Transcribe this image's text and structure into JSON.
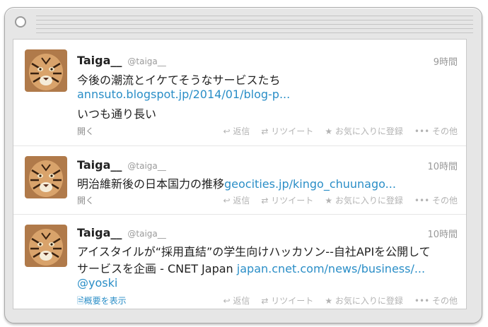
{
  "tweets": [
    {
      "name": "Taiga__",
      "handle": "@taiga__",
      "time": "9時間",
      "lines": [
        {
          "text": "今後の潮流とイケてそうなサービスたち",
          "link": ""
        },
        {
          "text": "",
          "link": "annsuto.blogspot.jp/2014/01/blog-p..."
        },
        {
          "text": "いつも通り長い",
          "link": ""
        }
      ],
      "expand": "開く"
    },
    {
      "name": "Taiga__",
      "handle": "@taiga__",
      "time": "10時間",
      "lines": [
        {
          "text": "明治維新後の日本国力の推移",
          "link": "geocities.jp/kingo_chuunago..."
        }
      ],
      "expand": "開く"
    },
    {
      "name": "Taiga__",
      "handle": "@taiga__",
      "time": "10時間",
      "lines": [
        {
          "text": "アイスタイルが“採用直結”の学生向けハッカソン--自社APIを公開して",
          "link": ""
        },
        {
          "text": "サービスを企画 - CNET Japan ",
          "link": "japan.cnet.com/news/business/..."
        },
        {
          "text": "",
          "link": "@yoski"
        }
      ],
      "summary": "概要を表示"
    }
  ],
  "actions": {
    "reply": "返信",
    "retweet": "リツイート",
    "favorite": "お気に入りに登録",
    "more": "その他"
  },
  "icons": {
    "reply": "reply-arrow-icon",
    "retweet": "retweet-icon",
    "favorite": "star-icon",
    "more": "ellipsis-icon",
    "summary": "document-icon"
  }
}
